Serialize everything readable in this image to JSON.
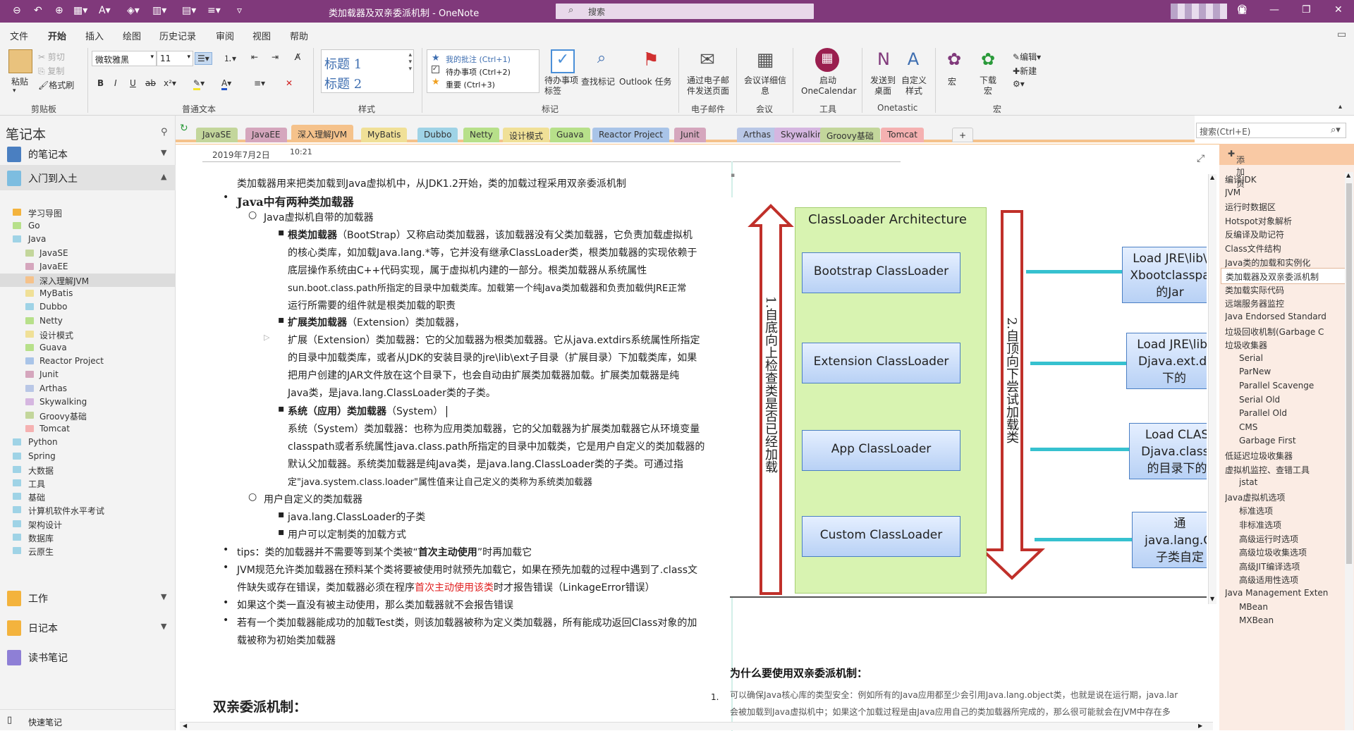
{
  "titlebar": {
    "title": "类加载器及双亲委派机制  -  OneNote",
    "search_placeholder": "搜索"
  },
  "menu": {
    "tabs": [
      "文件",
      "开始",
      "插入",
      "绘图",
      "历史记录",
      "审阅",
      "视图",
      "帮助"
    ]
  },
  "ribbon": {
    "clipboard": {
      "paste": "粘贴",
      "cut": "剪切",
      "copy": "复制",
      "format_painter": "格式刷",
      "label": "剪贴板"
    },
    "basic_text": {
      "font": "微软雅黑",
      "size": "11",
      "label": "普通文本"
    },
    "styles": {
      "h1": "标题 1",
      "h2": "标题 2",
      "label": "样式"
    },
    "tags": {
      "items": [
        "我的批注 (Ctrl+1)",
        "待办事项 (Ctrl+2)",
        "重要 (Ctrl+3)"
      ],
      "todo_tag": "待办事项标签",
      "find_tags": "查找标记",
      "outlook_task": "Outlook 任务",
      "label": "标记"
    },
    "email": {
      "send": "通过电子邮件发送页面",
      "label": "电子邮件"
    },
    "meeting": {
      "details": "会议详细信息",
      "label": "会议"
    },
    "tools": {
      "onecalendar": "启动 OneCalendar",
      "label": "工具"
    },
    "onetastic": {
      "send_desktop": "发送到桌面",
      "custom_style": "自定义样式",
      "label": "Onetastic"
    },
    "macros": {
      "macro": "宏",
      "download": "下载宏",
      "edit": "编辑",
      "new": "新建",
      "label": "宏"
    }
  },
  "notebooks": {
    "header": "笔记本",
    "items": [
      {
        "name": "的笔记本",
        "color": "#4a7fc1"
      },
      {
        "name": "入门到入土",
        "color": "#7dbde0"
      },
      {
        "name": "工作",
        "color": "#f3b33d"
      },
      {
        "name": "日记本",
        "color": "#f3b33d"
      },
      {
        "name": "读书笔记",
        "color": "#8e7fd6"
      }
    ],
    "sections": [
      "学习导图",
      "Go",
      "Java",
      "JavaSE",
      "JavaEE",
      "深入理解JVM",
      "MyBatis",
      "Dubbo",
      "Netty",
      "设计模式",
      "Guava",
      "Reactor Project",
      "Junit",
      "Arthas",
      "Skywalking",
      "Groovy基础",
      "Tomcat",
      "Python",
      "Spring",
      "大数据",
      "工具",
      "基础",
      "计算机软件水平考试",
      "架构设计",
      "数据库",
      "云原生"
    ],
    "quick_notes": "快速笔记"
  },
  "section_tabs": [
    {
      "label": "JavaSE",
      "color": "#c3d69b"
    },
    {
      "label": "JavaEE",
      "color": "#d5a6bd"
    },
    {
      "label": "深入理解JVM",
      "color": "#f5c28b"
    },
    {
      "label": "MyBatis",
      "color": "#f0e097"
    },
    {
      "label": "Dubbo",
      "color": "#9fd3e6"
    },
    {
      "label": "Netty",
      "color": "#b7e08a"
    },
    {
      "label": "设计模式",
      "color": "#f0e097"
    },
    {
      "label": "Guava",
      "color": "#b7e08a"
    },
    {
      "label": "Reactor Project",
      "color": "#a9c4e8"
    },
    {
      "label": "Junit",
      "color": "#d5a6bd"
    },
    {
      "label": "Arthas",
      "color": "#b9c7e6"
    },
    {
      "label": "Skywalking",
      "color": "#d5b6e0"
    },
    {
      "label": "Groovy基础",
      "color": "#c3d69b"
    },
    {
      "label": "Tomcat",
      "color": "#f5b1b1"
    },
    {
      "label": "+",
      "color": "#f3f3f3"
    }
  ],
  "page_search_placeholder": "搜索(Ctrl+E)",
  "pages": {
    "add_label": "添加页",
    "items": [
      {
        "t": "编译JDK",
        "sub": false
      },
      {
        "t": "JVM",
        "sub": false
      },
      {
        "t": "运行时数据区",
        "sub": false
      },
      {
        "t": "Hotspot对象解析",
        "sub": false
      },
      {
        "t": "反编译及助记符",
        "sub": false
      },
      {
        "t": "Class文件结构",
        "sub": false
      },
      {
        "t": "Java类的加载和实例化",
        "sub": false
      },
      {
        "t": "类加载器及双亲委派机制",
        "sub": false,
        "cur": true
      },
      {
        "t": "类加载实际代码",
        "sub": false
      },
      {
        "t": "远端服务器监控",
        "sub": false
      },
      {
        "t": "Java Endorsed Standard",
        "sub": false
      },
      {
        "t": "垃圾回收机制(Garbage C",
        "sub": false
      },
      {
        "t": "垃圾收集器",
        "sub": false
      },
      {
        "t": "Serial",
        "sub": true
      },
      {
        "t": "ParNew",
        "sub": true
      },
      {
        "t": "Parallel Scavenge",
        "sub": true
      },
      {
        "t": "Serial Old",
        "sub": true
      },
      {
        "t": "Parallel Old",
        "sub": true
      },
      {
        "t": "CMS",
        "sub": true
      },
      {
        "t": "Garbage First",
        "sub": true
      },
      {
        "t": "低延迟垃圾收集器",
        "sub": false
      },
      {
        "t": "虚拟机监控、查错工具",
        "sub": false
      },
      {
        "t": "jstat",
        "sub": true
      },
      {
        "t": "Java虚拟机选项",
        "sub": false
      },
      {
        "t": "标准选项",
        "sub": true
      },
      {
        "t": "非标准选项",
        "sub": true
      },
      {
        "t": "高级运行时选项",
        "sub": true
      },
      {
        "t": "高级垃圾收集选项",
        "sub": true
      },
      {
        "t": "高级JIT编译选项",
        "sub": true
      },
      {
        "t": "高级适用性选项",
        "sub": true
      },
      {
        "t": "Java Management Exten",
        "sub": false
      },
      {
        "t": "MBean",
        "sub": true
      },
      {
        "t": "MXBean",
        "sub": true
      }
    ]
  },
  "page": {
    "date": "2019年7月2日",
    "time": "10:21",
    "l1": "类加载器用来把类加载到Java虚拟机中，从JDK1.2开始，类的加载过程采用双亲委派机制",
    "l2": "Java中有两种类加载器",
    "l3": "Java虚拟机自带的加载器",
    "l4a": "根类加载器",
    "l4b": "（BootStrap）又称启动类加载器，该加载器没有父类加载器，它负责加载虚拟机",
    "l5": "的核心类库，如加载Java.lang.*等，它并没有继承ClassLoader类，根类加载器的实现依赖于",
    "l6": "底层操作系统由C++代码实现，属于虚拟机内建的一部分。根类加载器从系统属性",
    "l7": "sun.boot.class.path所指定的目录中加载类库。加载第一个纯Java类加载器和负责加载供JRE正常",
    "l8": "运行所需要的组件就是根类加载的职责",
    "l9a": "扩展类加载器",
    "l9b": "（Extension）类加载器，",
    "l10": "扩展（Extension）类加载器：它的父加载器为根类加载器。它从java.extdirs系统属性所指定",
    "l11": "的目录中加载类库，或者从JDK的安装目录的jre\\lib\\ext子目录（扩展目录）下加载类库，如果",
    "l12": "把用户创建的JAR文件放在这个目录下，也会自动由扩展类加载器加载。扩展类加载器是纯",
    "l13": "Java类，是java.lang.ClassLoader类的子类。",
    "l14a": "系统（应用）类加载器",
    "l14b": "（System）",
    "l15": "系统（System）类加载器：也称为应用类加载器，它的父加载器为扩展类加载器它从环境变量",
    "l16": "classpath或者系统属性java.class.path所指定的目录中加载类，它是用户自定义的类加载器的",
    "l17": "默认父加载器。系统类加载器是纯Java类，是java.lang.ClassLoader类的子类。可通过指",
    "l18": "定\"java.system.class.loader\"属性值来让自己定义的类称为系统类加载器",
    "l19": "用户自定义的类加载器",
    "l20": "java.lang.ClassLoader的子类",
    "l21": "用户可以定制类的加载方式",
    "l22a": "tips：类的加载器并不需要等到某个类被“",
    "l22b": "首次主动使用",
    "l22c": "”时再加载它",
    "l23": "JVM规范允许类加载器在预料某个类将要被使用时就预先加载它，如果在预先加载的过程中遇到了.class文",
    "l24a": "件缺失或存在错误，类加载器必须在程序",
    "l24b": "首次主动使用该类",
    "l24c": "时才报告错误（LinkageError错误）",
    "l25": "如果这个类一直没有被主动使用，那么类加载器就不会报告错误",
    "l26": "若有一个类加载器能成功的加载Test类，则该加载器被称为定义类加载器，所有能成功返回Class对象的加",
    "l27": "载被称为初始类加载器",
    "l28": "双亲委派机制：",
    "num": "1.",
    "why_title": "为什么要使用双亲委派机制：",
    "why1": "可以确保Java核心库的类型安全：例如所有的Java应用都至少会引用Java.lang.object类，也就是说在运行期，java.lar",
    "why2": "会被加载到Java虚拟机中；如果这个加载过程是由Java应用自己的类加载器所完成的，那么很可能就会在JVM中存在多"
  },
  "diagram": {
    "title": "ClassLoader Architecture",
    "loaders": [
      "Bootstrap ClassLoader",
      "Extension ClassLoader",
      "App ClassLoader",
      "Custom ClassLoader"
    ],
    "left_text": "1.自底向上检查类是否已经加载",
    "right_text": "2.自顶向下尝试加载类",
    "targets": [
      "Load JRE\\lib\\ Xbootclasspa 的Jar",
      "Load JRE\\lib\\ Djava.ext.di 下的",
      "Load CLAS Djava.class. 的目录下的",
      "通 java.lang.Cl 子类自定"
    ]
  }
}
